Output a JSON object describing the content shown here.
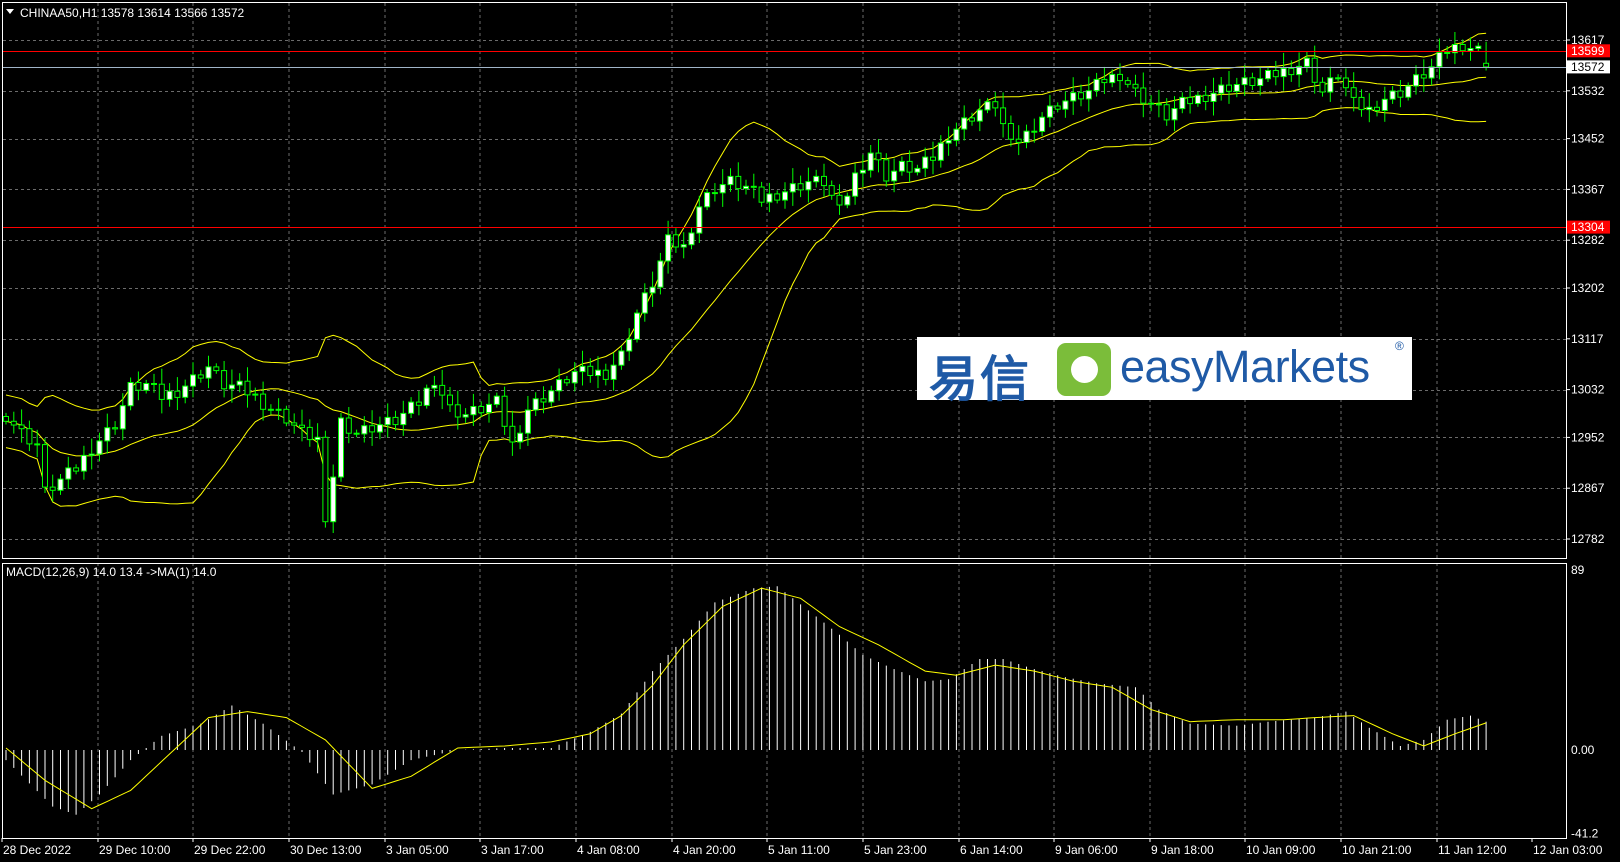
{
  "main_header": "CHINAA50,H1  13578 13614 13566 13572",
  "macd_header": "MACD(12,26,9) 14.0 13.4  ->MA(1) 14.0",
  "price_axis_ticks": [
    "13617",
    "13532",
    "13452",
    "13367",
    "13282",
    "13202",
    "13117",
    "13032",
    "12952",
    "12867",
    "12782"
  ],
  "macd_axis_ticks": [
    "89",
    "0.00",
    "-41.2"
  ],
  "time_axis_labels": [
    "28 Dec 2022",
    "29 Dec 10:00",
    "29 Dec 22:00",
    "30 Dec 13:00",
    "3 Jan 05:00",
    "3 Jan 17:00",
    "4 Jan 08:00",
    "4 Jan 20:00",
    "5 Jan 11:00",
    "5 Jan 23:00",
    "6 Jan 14:00",
    "9 Jan 06:00",
    "9 Jan 18:00",
    "10 Jan 09:00",
    "10 Jan 21:00",
    "11 Jan 12:00",
    "12 Jan 03:00"
  ],
  "price_lines": [
    {
      "value": 13599,
      "label": "13599",
      "color": "#ff0000",
      "label_bg": "#ff0000"
    },
    {
      "value": 13304,
      "label": "13304",
      "color": "#ff0000",
      "label_bg": "#ff0000"
    },
    {
      "value": 13572,
      "label": "13572",
      "color": "#a0b4c8",
      "label_bg": "#ffffff"
    }
  ],
  "logo": {
    "cjk": "易信",
    "brand": "easyMarkets",
    "reg": "®"
  },
  "colors": {
    "bg": "#000000",
    "grid": "#6b6b6b",
    "bull": "#00ff00",
    "bear": "#ffffff",
    "bull_body": "#ffffff",
    "bands": "#ffff00",
    "signal": "#ffff00",
    "histogram": "#ffffff",
    "logo_blue": "#1f5aa6",
    "logo_green": "#7bbd3a"
  },
  "chart_data": [
    {
      "type": "candlestick",
      "symbol": "CHINAA50",
      "timeframe": "H1",
      "indicators": [
        "Bollinger Bands"
      ],
      "ylim": [
        12740,
        13660
      ],
      "close_anchors": [
        [
          0,
          12990
        ],
        [
          2,
          12960
        ],
        [
          4,
          12940
        ],
        [
          5,
          12860
        ],
        [
          7,
          12880
        ],
        [
          9,
          12900
        ],
        [
          11,
          12935
        ],
        [
          14,
          12975
        ],
        [
          16,
          13035
        ],
        [
          18,
          13040
        ],
        [
          20,
          13020
        ],
        [
          22,
          13030
        ],
        [
          24,
          13050
        ],
        [
          26,
          13070
        ],
        [
          28,
          13040
        ],
        [
          30,
          13035
        ],
        [
          32,
          13020
        ],
        [
          34,
          13000
        ],
        [
          36,
          12985
        ],
        [
          38,
          12960
        ],
        [
          40,
          12950
        ],
        [
          41,
          12800
        ],
        [
          43,
          12980
        ],
        [
          45,
          12960
        ],
        [
          47,
          12970
        ],
        [
          50,
          12980
        ],
        [
          53,
          13010
        ],
        [
          55,
          13050
        ],
        [
          57,
          13000
        ],
        [
          59,
          12990
        ],
        [
          61,
          13000
        ],
        [
          63,
          13010
        ],
        [
          65,
          12940
        ],
        [
          67,
          13000
        ],
        [
          69,
          13020
        ],
        [
          71,
          13040
        ],
        [
          73,
          13060
        ],
        [
          75,
          13060
        ],
        [
          77,
          13060
        ],
        [
          79,
          13090
        ],
        [
          81,
          13160
        ],
        [
          83,
          13210
        ],
        [
          85,
          13280
        ],
        [
          87,
          13270
        ],
        [
          89,
          13340
        ],
        [
          91,
          13370
        ],
        [
          93,
          13380
        ],
        [
          95,
          13370
        ],
        [
          97,
          13350
        ],
        [
          99,
          13360
        ],
        [
          101,
          13370
        ],
        [
          103,
          13380
        ],
        [
          105,
          13380
        ],
        [
          107,
          13330
        ],
        [
          109,
          13390
        ],
        [
          111,
          13430
        ],
        [
          113,
          13390
        ],
        [
          115,
          13405
        ],
        [
          117,
          13400
        ],
        [
          119,
          13420
        ],
        [
          121,
          13460
        ],
        [
          123,
          13480
        ],
        [
          125,
          13500
        ],
        [
          127,
          13510
        ],
        [
          129,
          13440
        ],
        [
          131,
          13460
        ],
        [
          133,
          13490
        ],
        [
          135,
          13510
        ],
        [
          137,
          13520
        ],
        [
          139,
          13530
        ],
        [
          141,
          13550
        ],
        [
          143,
          13560
        ],
        [
          145,
          13530
        ],
        [
          147,
          13510
        ],
        [
          149,
          13490
        ],
        [
          151,
          13510
        ],
        [
          153,
          13520
        ],
        [
          155,
          13530
        ],
        [
          157,
          13540
        ],
        [
          159,
          13545
        ],
        [
          161,
          13550
        ],
        [
          163,
          13560
        ],
        [
          165,
          13570
        ],
        [
          167,
          13580
        ],
        [
          169,
          13530
        ],
        [
          171,
          13560
        ],
        [
          173,
          13510
        ],
        [
          175,
          13500
        ],
        [
          177,
          13520
        ],
        [
          179,
          13530
        ],
        [
          181,
          13550
        ],
        [
          183,
          13570
        ],
        [
          185,
          13600
        ],
        [
          187,
          13610
        ],
        [
          189,
          13600
        ],
        [
          190,
          13572
        ]
      ],
      "last": {
        "open": 13578,
        "high": 13614,
        "low": 13566,
        "close": 13572
      }
    },
    {
      "type": "macd",
      "params": [
        12,
        26,
        9
      ],
      "values": {
        "macd": 14.0,
        "signal": 13.4
      },
      "ylim": [
        -41.2,
        89
      ],
      "hist_anchors": [
        [
          0,
          -5
        ],
        [
          6,
          -28
        ],
        [
          9,
          -32
        ],
        [
          12,
          -22
        ],
        [
          16,
          -5
        ],
        [
          20,
          7
        ],
        [
          25,
          13
        ],
        [
          29,
          22
        ],
        [
          33,
          13
        ],
        [
          38,
          -1
        ],
        [
          42,
          -22
        ],
        [
          47,
          -17
        ],
        [
          52,
          -5
        ],
        [
          58,
          0
        ],
        [
          64,
          1
        ],
        [
          70,
          1
        ],
        [
          75,
          9
        ],
        [
          79,
          18
        ],
        [
          83,
          39
        ],
        [
          87,
          55
        ],
        [
          91,
          73
        ],
        [
          96,
          80
        ],
        [
          99,
          81
        ],
        [
          102,
          72
        ],
        [
          107,
          57
        ],
        [
          110,
          47
        ],
        [
          114,
          40
        ],
        [
          118,
          34
        ],
        [
          121,
          35
        ],
        [
          125,
          45
        ],
        [
          128,
          45
        ],
        [
          132,
          40
        ],
        [
          136,
          36
        ],
        [
          140,
          33
        ],
        [
          145,
          31
        ],
        [
          148,
          20
        ],
        [
          152,
          13
        ],
        [
          158,
          12
        ],
        [
          162,
          14
        ],
        [
          168,
          16
        ],
        [
          172,
          19
        ],
        [
          175,
          11
        ],
        [
          179,
          2
        ],
        [
          182,
          5
        ],
        [
          185,
          15
        ],
        [
          188,
          17
        ],
        [
          190,
          14
        ]
      ],
      "signal_anchors": [
        [
          0,
          1
        ],
        [
          5,
          -15
        ],
        [
          11,
          -29
        ],
        [
          16,
          -20
        ],
        [
          21,
          -2
        ],
        [
          26,
          16
        ],
        [
          31,
          19
        ],
        [
          36,
          16
        ],
        [
          41,
          5
        ],
        [
          47,
          -19
        ],
        [
          52,
          -13
        ],
        [
          58,
          1
        ],
        [
          64,
          2
        ],
        [
          70,
          4
        ],
        [
          75,
          8
        ],
        [
          79,
          17
        ],
        [
          83,
          32
        ],
        [
          87,
          52
        ],
        [
          92,
          71
        ],
        [
          97,
          80
        ],
        [
          102,
          75
        ],
        [
          107,
          61
        ],
        [
          112,
          52
        ],
        [
          118,
          39
        ],
        [
          122,
          37
        ],
        [
          127,
          42
        ],
        [
          132,
          39
        ],
        [
          137,
          34
        ],
        [
          142,
          31
        ],
        [
          147,
          20
        ],
        [
          152,
          14
        ],
        [
          158,
          15
        ],
        [
          164,
          15
        ],
        [
          168,
          16
        ],
        [
          173,
          17
        ],
        [
          178,
          8
        ],
        [
          182,
          2
        ],
        [
          186,
          8
        ],
        [
          190,
          13.4
        ]
      ]
    }
  ]
}
